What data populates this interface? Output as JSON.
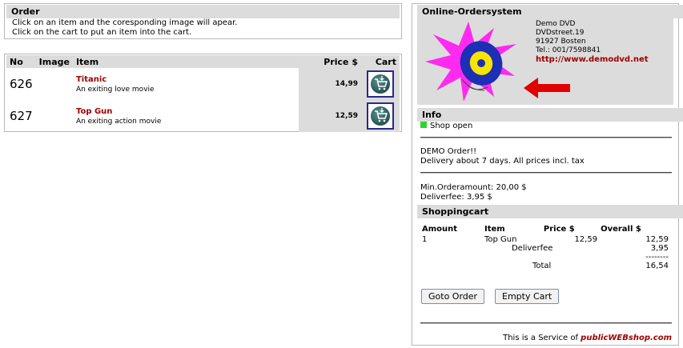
{
  "order_box": {
    "title": "Order",
    "line1": "Click on an item and the coresponding image will apear.",
    "line2": "Click on the cart to put an item into the cart."
  },
  "product_table": {
    "headers": {
      "no": "No",
      "image": "Image",
      "item": "Item",
      "price": "Price $",
      "cart": "Cart"
    },
    "rows": [
      {
        "no": "626",
        "name": "Titanic",
        "desc": "An exiting love movie",
        "price": "14,99"
      },
      {
        "no": "627",
        "name": "Top Gun",
        "desc": "An exiting action movie",
        "price": "12,59"
      }
    ]
  },
  "shop": {
    "title": "Online-Ordersystem",
    "company": {
      "name": "Demo DVD",
      "street": "DVDstreet.19",
      "city": "91927 Bosten",
      "phone": "Tel.: 001/7598841",
      "url": "http://www.demodvd.net"
    },
    "info_title": "Info",
    "status": "Shop open",
    "notice1": "DEMO Order!!",
    "notice2": "Delivery about 7 days. All prices incl. tax",
    "min_order": "Min.Orderamount:  20,00  $",
    "deliver_fee": "Deliverfee:  3,95  $"
  },
  "shopping_cart": {
    "title": "Shoppingcart",
    "headers": {
      "amount": "Amount",
      "item": "Item",
      "price": "Price $",
      "overall": "Overall $"
    },
    "row": {
      "amount": "1",
      "item": "Top Gun",
      "price": "12,59",
      "overall": "12,59"
    },
    "deliverfee_label": "Deliverfee",
    "deliverfee_value": "3,95",
    "separator": "--------",
    "total_label": "Total",
    "total_value": "16,54",
    "goto_order": "Goto Order",
    "empty_cart": "Empty Cart"
  },
  "footer": {
    "prefix": "This is a Service of",
    "brand_part1": "public",
    "brand_part2": "WEB",
    "brand_part3": "shop.com"
  },
  "colors": {
    "accent_red": "#a10000",
    "status_green": "#2bd52b",
    "arrow_red": "#e00000"
  },
  "icons": [
    "dvd-logo-icon",
    "red-arrow-icon",
    "cart-icon",
    "green-status-icon"
  ]
}
